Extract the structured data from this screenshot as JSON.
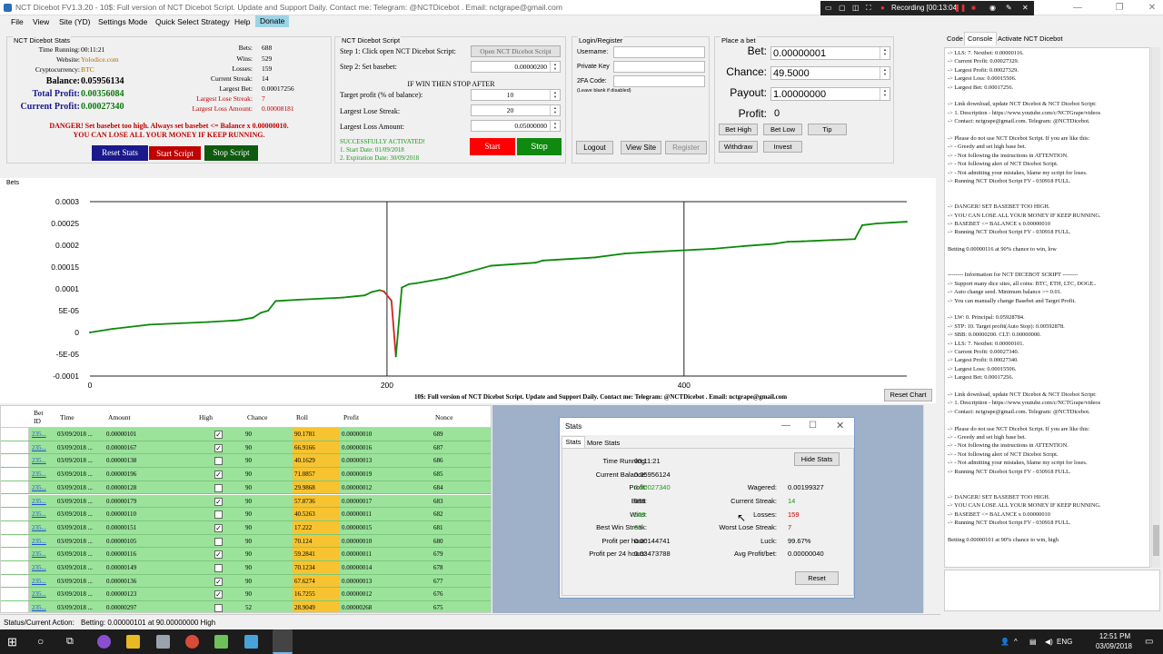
{
  "window": {
    "title": "NCT Dicebot FV1.3.20   -   10$: Full version of NCT Dicebot Script. Update and Support Daily.  Contact me:  Telegram: @NCTDicebot . Email: nctgrape@gmail.com"
  },
  "recording": {
    "label": "Recording [00:13:04]"
  },
  "menu": {
    "file": "File",
    "view": "View",
    "site": "Site (YD)",
    "settings": "Settings Mode",
    "quick": "Quick Select Strategy",
    "help": "Help",
    "donate": "Donate"
  },
  "stats_group": {
    "title": "NCT Dicebot Stats",
    "time_label": "Time Running:",
    "time_value": "00:11:21",
    "website_label": "Website:",
    "website_value": "Yolodice.com",
    "crypto_label": "Cryptocurrency:",
    "crypto_value": "BTC",
    "balance_label": "Balance:",
    "balance_value": "0.05956134",
    "total_label": "Total Profit:",
    "total_value": "0.00356084",
    "current_label": "Current Profit:",
    "current_value": "0.00027340",
    "bets_label": "Bets:",
    "bets_value": "688",
    "wins_label": "Wins:",
    "wins_value": "529",
    "losses_label": "Losses:",
    "losses_value": "159",
    "streak_label": "Current Streak:",
    "streak_value": "14",
    "largest_bet_label": "Largest Bet:",
    "largest_bet_value": "0.00017256",
    "lose_streak_label": "Largest Lose Streak:",
    "lose_streak_value": "7",
    "loss_amount_label": "Largest Loss Amount:",
    "loss_amount_value": "0.00008181",
    "danger1": "DANGER! Set basebet too high. Always set basebet <= Balance x 0.00000010.",
    "danger2": "YOU CAN LOSE ALL YOUR MONEY IF KEEP RUNNING.",
    "reset": "Reset Stats",
    "start": "Start Script",
    "stop": "Stop Script"
  },
  "script_group": {
    "title": "NCT Dicebot Script",
    "step1": "Step 1: Click open NCT Dicebot Script:",
    "open_btn": "Open NCT Dicebot Script",
    "step2": "Step 2: Set basebet:",
    "basebet": "0.00000200",
    "if_win": "IF WIN THEN STOP AFTER",
    "target_label": "Target profit (% of balance):",
    "target": "10",
    "streak_label": "Largest Lose Streak:",
    "streak": "20",
    "loss_label": "Largest Loss Amount:",
    "loss": "0.05000000",
    "activated": "SUCCESSFULLY ACTIVATED!",
    "start_date": "1. Start Date: 01/09/2018",
    "exp_date": "2. Expiration Date: 30/09/2018",
    "start": "Start",
    "stop": "Stop"
  },
  "login_group": {
    "title": "Login/Register",
    "username": "Username:",
    "private_key": "Private Key",
    "twofa": "2FA Code:",
    "blank": "(Leave blank if disabled)",
    "logout": "Logout",
    "view_site": "View Site",
    "register": "Register"
  },
  "bet_group": {
    "title": "Place a bet",
    "bet_label": "Bet:",
    "bet": "0.00000001",
    "chance_label": "Chance:",
    "chance": "49.5000",
    "payout_label": "Payout:",
    "payout": "1.00000000",
    "profit_label": "Profit:",
    "profit": "0",
    "bet_high": "Bet High",
    "bet_low": "Bet Low",
    "tip": "Tip",
    "withdraw": "Withdraw",
    "invest": "Invest"
  },
  "chart_data": {
    "type": "line",
    "title": "",
    "legend_label": "Bets",
    "xlabel": "",
    "ylabel": "",
    "xlim": [
      0,
      550
    ],
    "ylim": [
      -0.0001,
      0.0003
    ],
    "x_ticks": [
      "0",
      "200",
      "400"
    ],
    "y_ticks": [
      "0.0003",
      "0.00025",
      "0.0002",
      "0.00015",
      "0.0001",
      "5E-05",
      "0",
      "-5E-05",
      "-0.0001"
    ],
    "series": [
      {
        "color_up": "#0a8a0a",
        "color_down": "#d42020",
        "x": [
          0,
          15,
          40,
          80,
          100,
          110,
          115,
          120,
          125,
          140,
          170,
          185,
          190,
          195,
          198,
          203,
          206,
          210,
          215,
          220,
          240,
          270,
          300,
          305,
          340,
          360,
          380,
          420,
          440,
          460,
          470,
          480,
          500,
          515,
          520,
          530,
          540,
          550
        ],
        "y": [
          0,
          8e-06,
          1.8e-05,
          2.4e-05,
          2.8e-05,
          3.4e-05,
          4.5e-05,
          5e-05,
          7.2e-05,
          7.5e-05,
          8e-05,
          8.5e-05,
          9.3e-05,
          9.7e-05,
          9.4e-05,
          7.3e-05,
          -5.5e-05,
          0.000103,
          0.000111,
          0.000113,
          0.000125,
          0.000153,
          0.00016,
          0.000165,
          0.000172,
          0.000181,
          0.000185,
          0.000192,
          0.000198,
          0.000203,
          0.000208,
          0.000209,
          0.000212,
          0.000214,
          0.000246,
          0.00025,
          0.000252,
          0.000254
        ]
      }
    ],
    "footer": "10$: Full version of NCT Dicebot Script. Update and Support Daily.  Contact me:  Telegram: @NCTDicebot . Email: nctgrape@gmail.com",
    "reset_chart": "Reset Chart"
  },
  "grid": {
    "headers": [
      "Bet ID",
      "Time",
      "Amount",
      "High",
      "Chance",
      "Roll",
      "Profit",
      "Nonce"
    ],
    "rows": [
      {
        "id": "235...",
        "time": "03/09/2018 ...",
        "amount": "0.00000101",
        "high": "✓",
        "chance": "90",
        "roll": "90.1781",
        "profit": "0.00000010",
        "nonce": "689"
      },
      {
        "id": "235...",
        "time": "03/09/2018 ...",
        "amount": "0.00000167",
        "high": "✓",
        "chance": "90",
        "roll": "66.9166",
        "profit": "0.00000016",
        "nonce": "687"
      },
      {
        "id": "235...",
        "time": "03/09/2018 ...",
        "amount": "0.00000138",
        "high": "",
        "chance": "90",
        "roll": "40.1629",
        "profit": "0.00000013",
        "nonce": "686"
      },
      {
        "id": "235...",
        "time": "03/09/2018 ...",
        "amount": "0.00000196",
        "high": "✓",
        "chance": "90",
        "roll": "71.0857",
        "profit": "0.00000019",
        "nonce": "685"
      },
      {
        "id": "235...",
        "time": "03/09/2018 ...",
        "amount": "0.00000128",
        "high": "",
        "chance": "90",
        "roll": "29.9868",
        "profit": "0.00000012",
        "nonce": "684"
      },
      {
        "id": "235...",
        "time": "03/09/2018 ...",
        "amount": "0.00000179",
        "high": "✓",
        "chance": "90",
        "roll": "57.8736",
        "profit": "0.00000017",
        "nonce": "683"
      },
      {
        "id": "235...",
        "time": "03/09/2018 ...",
        "amount": "0.00000110",
        "high": "",
        "chance": "90",
        "roll": "40.5263",
        "profit": "0.00000011",
        "nonce": "682"
      },
      {
        "id": "235...",
        "time": "03/09/2018 ...",
        "amount": "0.00000151",
        "high": "✓",
        "chance": "90",
        "roll": "17.222",
        "profit": "0.00000015",
        "nonce": "681"
      },
      {
        "id": "235...",
        "time": "03/09/2018 ...",
        "amount": "0.00000105",
        "high": "",
        "chance": "90",
        "roll": "70.124",
        "profit": "0.00000010",
        "nonce": "680"
      },
      {
        "id": "235...",
        "time": "03/09/2018 ...",
        "amount": "0.00000116",
        "high": "✓",
        "chance": "90",
        "roll": "59.2841",
        "profit": "0.00000011",
        "nonce": "679"
      },
      {
        "id": "235...",
        "time": "03/09/2018 ...",
        "amount": "0.00000149",
        "high": "",
        "chance": "90",
        "roll": "70.1234",
        "profit": "0.00000014",
        "nonce": "678"
      },
      {
        "id": "235...",
        "time": "03/09/2018 ...",
        "amount": "0.00000136",
        "high": "✓",
        "chance": "90",
        "roll": "67.6274",
        "profit": "0.00000013",
        "nonce": "677"
      },
      {
        "id": "235...",
        "time": "03/09/2018 ...",
        "amount": "0.00000123",
        "high": "✓",
        "chance": "90",
        "roll": "16.7255",
        "profit": "0.00000012",
        "nonce": "676"
      },
      {
        "id": "235...",
        "time": "03/09/2018 ...",
        "amount": "0.00000297",
        "high": "",
        "chance": "52",
        "roll": "28.9049",
        "profit": "0.00000268",
        "nonce": "675"
      }
    ]
  },
  "stats_window": {
    "title": "Stats",
    "tab1": "Stats",
    "tab2": "More Stats",
    "hide": "Hide Stats",
    "reset": "Reset",
    "time_label": "Time Running:",
    "time": "00:11:21",
    "balance_label": "Current Balance:",
    "balance": "0.05956124",
    "profit_label": "Profit:",
    "profit": "0.00027340",
    "bets_label": "Bets:",
    "bets": "688",
    "wins_label": "Wins:",
    "wins": "529",
    "best_label": "Best Win Streak:",
    "best": "30",
    "pph_label": "Profit per hour:",
    "pph": "0.00144741",
    "p24_label": "Profit per 24 hours:",
    "p24": "0.03473788",
    "wagered_label": "Wagered:",
    "wagered": "0.00199327",
    "cur_streak_label": "Current Streak:",
    "cur_streak": "14",
    "losses_label": "Losses:",
    "losses": "159",
    "worst_label": "Worst Lose Streak:",
    "worst": "7",
    "luck_label": "Luck:",
    "luck": "99.67%",
    "avg_label": "Avg Profit/bet:",
    "avg": "0.00000040"
  },
  "status": {
    "label": "Status/Current Action:",
    "value": "Betting: 0.00000101 at 90.00000000 High"
  },
  "right_tabs": {
    "code": "Code",
    "console": "Console",
    "activate": "Activate NCT Dicebot"
  },
  "console_lines": [
    "-> LLS: 7. Nextbet: 0.00000116.",
    "-> Current Profit: 0.00027329.",
    "-> Largest Profit: 0.00027329.",
    "-> Largest Loss: 0.00015506.",
    "-> Largest Bet: 0.00017256.",
    "",
    "-> Link download, update NCT Dicebot & NCT Dicebot Script:",
    "-> 1. Description - https://www.youtube.com/c/NCTGrape/videos",
    "-> Contact: nctgrape@gmail.com. Telegram: @NCTDicebot.",
    "",
    "-> Please do not use NCT Dicebot Script. If you are like this:",
    "-> - Greedy and set high base bet.",
    "-> - Not following the instructions in ATTENTION.",
    "-> - Not following alert of NCT Dicebot Script.",
    "-> - Not admitting your mistakes, blame my script for loses.",
    "-> Running NCT Dicebot Script FV - 030918 FULL.",
    "",
    "",
    "-> DANGER! SET BASEBET TOO HIGH.",
    "-> YOU CAN LOSE ALL YOUR MONEY IF KEEP RUNNING.",
    "-> BASEBET <= BALANCE x 0.00000010",
    "-> Running NCT Dicebot Script FV - 030918 FULL.",
    "",
    "Betting 0.00000116 at 90% chance to win, low",
    "",
    "",
    "-------- Information for NCT DICEBOT SCRIPT --------",
    "-> Support many dice sites, all coins: BTC, ETH, LTC, DOGE..",
    "-> Auto change seed. Minimum balance >= 0.01.",
    "-> You can manually change Basebet and Target Profit.",
    "",
    "-> LW: 0. Principal: 0.05928784.",
    "-> STP: 10. Target profit(Auto Stop): 0.00592878.",
    "-> SBB: 0.00000200. CLT: 0.00000000.",
    "-> LLS: 7. Nextbet: 0.00000101.",
    "-> Current Profit: 0.00027340.",
    "-> Largest Profit: 0.00027340.",
    "-> Largest Loss: 0.00015506.",
    "-> Largest Bet: 0.00017256.",
    "",
    "-> Link download, update NCT Dicebot & NCT Dicebot Script:",
    "-> 1. Description - https://www.youtube.com/c/NCTGrape/videos",
    "-> Contact: nctgrape@gmail.com. Telegram: @NCTDicebot.",
    "",
    "-> Please do not use NCT Dicebot Script. If you are like this:",
    "-> - Greedy and set high base bet.",
    "-> - Not following the instructions in ATTENTION.",
    "-> - Not following alert of NCT Dicebot Script.",
    "-> - Not admitting your mistakes, blame my script for loses.",
    "-> Running NCT Dicebot Script FV - 030918 FULL.",
    "",
    "",
    "-> DANGER! SET BASEBET TOO HIGH.",
    "-> YOU CAN LOSE ALL YOUR MONEY IF KEEP RUNNING.",
    "-> BASEBET <= BALANCE x 0.00000010",
    "-> Running NCT Dicebot Script FV - 030918 FULL.",
    "",
    "Betting 0.00000101 at 90% chance to win, high"
  ],
  "taskbar": {
    "time": "12:51 PM",
    "date": "03/09/2018",
    "lang": "ENG"
  },
  "colors": {
    "accent_blue": "#1a1a8c",
    "danger_red": "#c00000",
    "go_green": "#0f7a0f",
    "grid_green": "#9be29b",
    "roll_orange": "#f7c330"
  }
}
